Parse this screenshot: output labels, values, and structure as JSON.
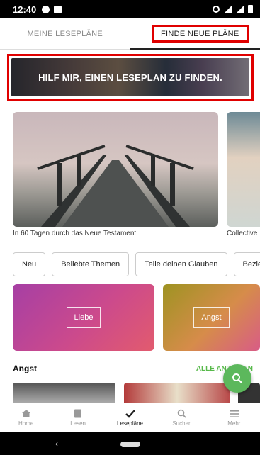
{
  "status_bar": {
    "time": "12:40"
  },
  "tabs": [
    {
      "label": "MEINE LESEPLÄNE",
      "active": false
    },
    {
      "label": "FINDE NEUE PLÄNE",
      "active": true
    }
  ],
  "banner": {
    "text": "HILF MIR, EINEN LESEPLAN ZU FINDEN."
  },
  "featured": [
    {
      "caption": "In 60 Tagen durch das Neue Testament"
    },
    {
      "caption": "Collective"
    }
  ],
  "chips": [
    "Neu",
    "Beliebte Themen",
    "Teile deinen Glauben",
    "Bezieh"
  ],
  "topics": [
    {
      "label": "Liebe",
      "color": "#c2449a"
    },
    {
      "label": "Angst",
      "color": "#c9903e"
    }
  ],
  "section": {
    "title": "Angst",
    "see_all": "ALLE ANZEIGEN"
  },
  "bottom_nav": [
    {
      "label": "Home",
      "icon": "home-icon",
      "active": false
    },
    {
      "label": "Lesen",
      "icon": "book-icon",
      "active": false
    },
    {
      "label": "Lesepläne",
      "icon": "check-icon",
      "active": true
    },
    {
      "label": "Suchen",
      "icon": "search-icon",
      "active": false
    },
    {
      "label": "Mehr",
      "icon": "menu-icon",
      "active": false
    }
  ],
  "colors": {
    "highlight": "#e00000",
    "accent_green": "#57b94a"
  }
}
